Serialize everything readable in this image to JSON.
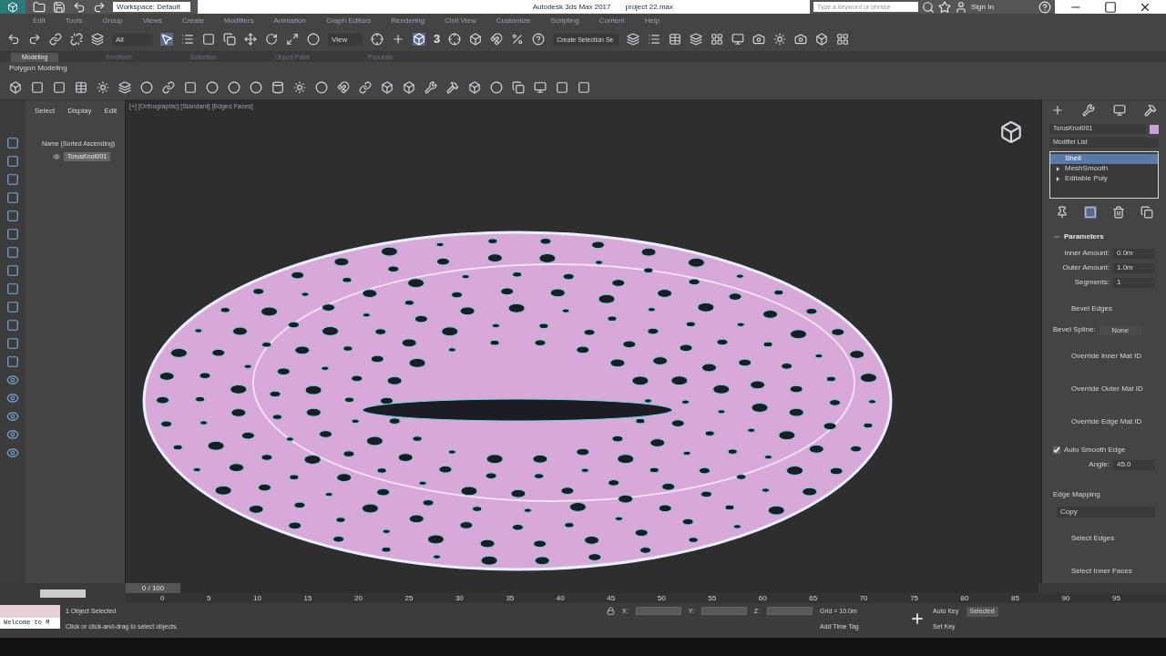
{
  "title_bar": {
    "workspace": "Workspace: Default",
    "app_title": "Autodesk 3ds Max 2017",
    "file": "project 22.max",
    "search": {
      "placeholder": "Type a keyword or phrase"
    },
    "sign_in": "Sign In"
  },
  "menu": [
    "Edit",
    "Tools",
    "Group",
    "Views",
    "Create",
    "Modifiers",
    "Animation",
    "Graph Editors",
    "Rendering",
    "Civil View",
    "Customize",
    "Scripting",
    "Content",
    "Help"
  ],
  "main_toolbar": {
    "filter": "All",
    "coordinate": "View",
    "snap": "3",
    "selection_set": "Create Selection Se"
  },
  "ribbon": {
    "tabs": [
      {
        "label": "Modeling",
        "selected": true
      },
      {
        "label": "Freeform",
        "selected": false
      },
      {
        "label": "Selection",
        "selected": false
      },
      {
        "label": "Object Paint",
        "selected": false
      },
      {
        "label": "Populate",
        "selected": false
      }
    ],
    "panel_label": "Polygon Modeling"
  },
  "scene_explorer": {
    "menu": [
      "Select",
      "Display",
      "Edit"
    ],
    "column": "Name (Sorted Ascending)",
    "items": [
      {
        "name": "TorusKnot001",
        "selected": true
      }
    ]
  },
  "viewport": {
    "label": "[+] [Orthographic] [Standard] [Edged Faces]"
  },
  "command_panel": {
    "object_name": "TorusKnot001",
    "color": "#c9a0dc",
    "modifier_list": "Modifier List",
    "stack": [
      {
        "name": "Shell",
        "selected": true,
        "has_children": false
      },
      {
        "name": "MeshSmooth",
        "selected": false,
        "has_children": true
      },
      {
        "name": "Editable Poly",
        "selected": false,
        "has_children": true
      }
    ],
    "rollout": "Parameters",
    "params": [
      {
        "kind": "spinner",
        "label": "Inner Amount:",
        "value": "0.0m"
      },
      {
        "kind": "spinner",
        "label": "Outer Amount:",
        "value": "1.0m"
      },
      {
        "kind": "spinner",
        "label": "Segments:",
        "value": "1"
      },
      {
        "kind": "label",
        "label": "Bevel Edges"
      },
      {
        "kind": "button",
        "label": "Bevel Spline:",
        "value": "None"
      },
      {
        "kind": "label",
        "label": "Override Inner Mat ID"
      },
      {
        "kind": "label",
        "label": "Override Outer Mat ID"
      },
      {
        "kind": "label",
        "label": "Override Edge Mat ID"
      },
      {
        "kind": "checkbox",
        "label": "Auto Smooth Edge",
        "checked": true
      },
      {
        "kind": "spinner",
        "label": "Angle:",
        "value": "45.0"
      },
      {
        "kind": "heading",
        "label": "Edge Mapping"
      },
      {
        "kind": "dropdown",
        "value": "Copy"
      },
      {
        "kind": "label",
        "label": "Select Edges"
      },
      {
        "kind": "label",
        "label": "Select Inner Faces"
      }
    ]
  },
  "timeline": {
    "frame": "0 / 100",
    "ticks": [
      "0",
      "5",
      "10",
      "15",
      "20",
      "25",
      "30",
      "35",
      "40",
      "45",
      "50",
      "55",
      "60",
      "65",
      "70",
      "75",
      "80",
      "85",
      "90",
      "95"
    ]
  },
  "status": {
    "maxscript": "Welcome to M",
    "selected": "1 Object Selected",
    "prompt": "Click or click-and-drag to select objects.",
    "x": "X:",
    "y": "Y:",
    "z": "Z:",
    "grid": "Grid = 10.0m",
    "add_time_tag": "Add Time Tag",
    "auto_key": "Auto Key",
    "selected_key": "Selected",
    "set_key": "Set Key"
  }
}
